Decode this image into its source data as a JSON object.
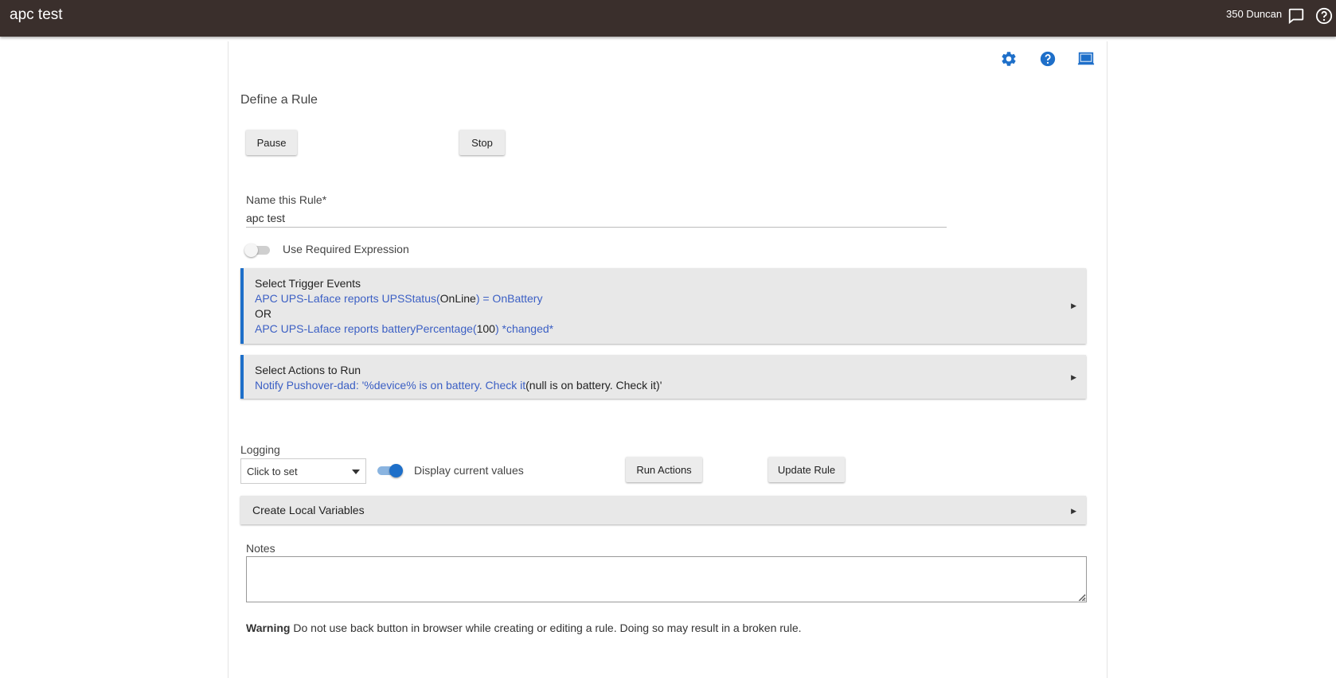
{
  "topbar": {
    "app_title": "apc test",
    "hub_name": "350 Duncan",
    "icons": [
      "chat-icon",
      "help-circle-icon"
    ]
  },
  "header_icons": [
    "gear-icon",
    "help-icon",
    "monitor-icon"
  ],
  "accent_color": "#1e6fc9",
  "section_title": "Define a Rule",
  "buttons": {
    "pause": "Pause",
    "stop": "Stop",
    "run_actions": "Run Actions",
    "update_rule": "Update Rule"
  },
  "rule_name": {
    "label": "Name this Rule*",
    "value": "apc test"
  },
  "required_expression": {
    "label": "Use Required Expression",
    "enabled": false
  },
  "triggers": {
    "title": "Select Trigger Events",
    "line1": {
      "prefix": "APC UPS-Laface reports UPSStatus(",
      "value": "OnLine",
      "suffix": ") = OnBattery"
    },
    "connector": "OR",
    "line2": {
      "prefix": "APC UPS-Laface reports batteryPercentage(",
      "value": "100",
      "suffix": ") *changed*"
    }
  },
  "actions": {
    "title": "Select Actions to Run",
    "line1": {
      "prefix": "Notify Pushover-dad: '%device% is on battery. Check it",
      "value": "(null is on battery. Check it)'"
    }
  },
  "logging": {
    "label": "Logging",
    "selected": "Click to set"
  },
  "display_values": {
    "label": "Display current values",
    "enabled": true
  },
  "local_variables": {
    "title": "Create Local Variables"
  },
  "notes": {
    "label": "Notes",
    "value": ""
  },
  "warning": {
    "strong": "Warning",
    "text": " Do not use back button in browser while creating or editing a rule. Doing so may result in a broken rule."
  }
}
